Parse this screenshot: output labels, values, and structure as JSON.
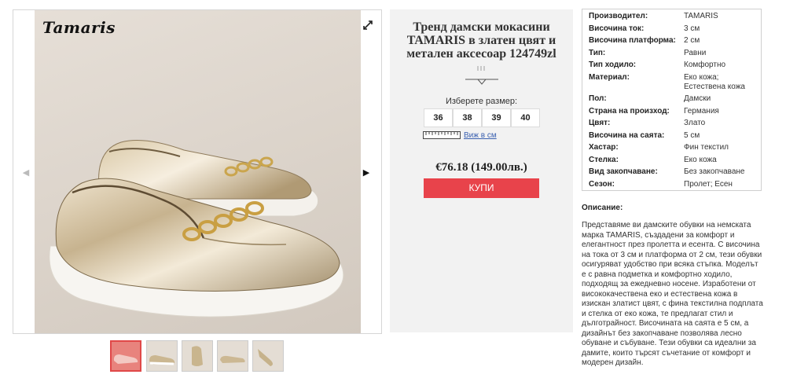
{
  "brand": {
    "logo_text": "Tamaris"
  },
  "gallery": {
    "main_image": "gold-loafer-photo",
    "thumbnails": [
      "thumb-1",
      "thumb-2",
      "thumb-3",
      "thumb-4",
      "thumb-5"
    ],
    "active_thumbnail": 1,
    "icons": {
      "expand": "expand-icon",
      "prev": "arrow-left-icon",
      "next": "arrow-right-icon"
    }
  },
  "product": {
    "title": "Тренд дамски мокасини TAMARIS в златен цвят и метален аксесоар 124749zl",
    "size_label": "Изберете размер:",
    "sizes": [
      "36",
      "38",
      "39",
      "40"
    ],
    "size_chart_link": "Виж в см",
    "price": "€76.18 (149.00лв.)",
    "buy_label": "КУПИ",
    "accent_color": "#e8434b"
  },
  "specs": [
    {
      "key": "Производител:",
      "value": "TAMARIS"
    },
    {
      "key": "Височина ток:",
      "value": "3 см"
    },
    {
      "key": "Височина платформа:",
      "value": "2 см"
    },
    {
      "key": "Тип:",
      "value": "Равни"
    },
    {
      "key": "Тип ходило:",
      "value": "Комфортно"
    },
    {
      "key": "Материал:",
      "value": "Еко кожа; Естествена кожа"
    },
    {
      "key": "Пол:",
      "value": "Дамски"
    },
    {
      "key": "Страна на произход:",
      "value": "Германия"
    },
    {
      "key": "Цвят:",
      "value": "Злато"
    },
    {
      "key": "Височина на саята:",
      "value": "5 см"
    },
    {
      "key": "Хастар:",
      "value": "Фин текстил"
    },
    {
      "key": "Стелка:",
      "value": "Еко кожа"
    },
    {
      "key": "Вид закопчаване:",
      "value": "Без закопчаване"
    },
    {
      "key": "Сезон:",
      "value": "Пролет; Есен"
    }
  ],
  "description": {
    "title": "Описание:",
    "text": "Представяме ви дамските обувки на немската марка TAMARIS, създадени за комфорт и елегантност през пролетта и есента. С височина на тока от 3 см и платформа от 2 см, тези обувки осигуряват удобство при всяка стъпка. Моделът е с равна подметка и комфортно ходило, подходящ за ежедневно носене. Изработени от висококачествена еко и естествена кожа в изискан златист цвят, с фина текстилна подплата и стелка от еко кожа, те предлагат стил и дълготрайност. Височината на саята е 5 см, а дизайнът без закопчаване позволява лесно обуване и събуване. Тези обувки са идеални за дамите, които търсят съчетание от комфорт и модерен дизайн."
  }
}
